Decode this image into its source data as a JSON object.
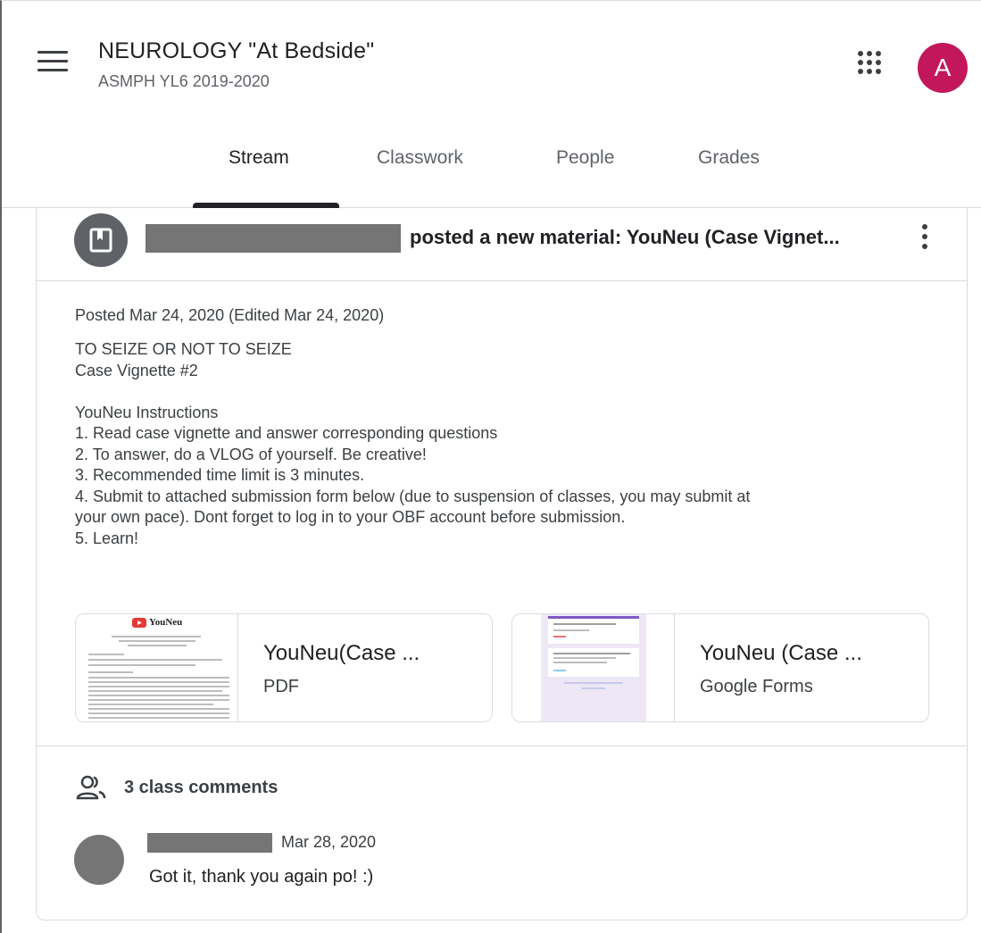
{
  "header": {
    "title": "NEUROLOGY \"At Bedside\"",
    "subtitle": "ASMPH YL6 2019-2020",
    "avatar_letter": "A",
    "colors": {
      "avatar": "#c2185b"
    }
  },
  "tabs": [
    {
      "label": "Stream",
      "active": true
    },
    {
      "label": "Classwork",
      "active": false
    },
    {
      "label": "People",
      "active": false
    },
    {
      "label": "Grades",
      "active": false
    }
  ],
  "post": {
    "icon": "book-icon",
    "title_suffix": "posted a new material: YouNeu (Case Vignet...",
    "posted": "Posted Mar 24, 2020 (Edited Mar 24, 2020)",
    "lines": [
      "TO SEIZE OR NOT TO SEIZE",
      "Case Vignette #2",
      "",
      "YouNeu Instructions",
      "1. Read case vignette and answer corresponding questions",
      "2. To answer, do a VLOG of yourself. Be creative!",
      "3. Recommended time limit is 3 minutes.",
      "4. Submit to attached submission form below (due to suspension of classes, you may submit at",
      "your own pace). Dont forget to log in to your OBF account before submission.",
      "5. Learn!"
    ],
    "attachments": [
      {
        "title": "YouNeu(Case ...",
        "type": "PDF",
        "thumb_logo": "YouNeu"
      },
      {
        "title": "YouNeu (Case ...",
        "type": "Google Forms"
      }
    ]
  },
  "comments": {
    "icon": "people-icon",
    "count_label": "3 class comments",
    "items": [
      {
        "date": "Mar 28, 2020",
        "text": "Got it, thank you again po! :)"
      }
    ]
  }
}
